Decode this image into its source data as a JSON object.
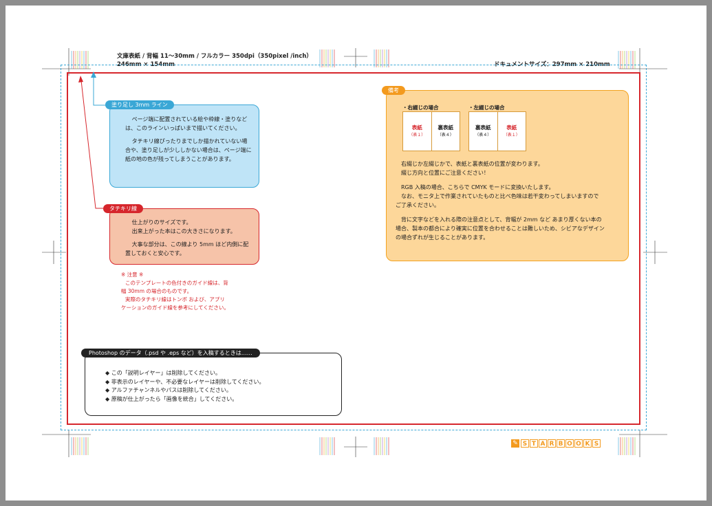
{
  "header": {
    "title_line1": "文庫表紙 / 背幅 11〜30mm / フルカラー 350dpi（350pixel /inch）",
    "title_line2": "246mm × 154mm",
    "doc_size": "ドキュメントサイズ：297mm × 210mm"
  },
  "bleed_box": {
    "tag": "塗り足し 3mm ライン",
    "para1": "ページ端に配置されている絵や枠線・塗りなどは、このラインいっぱいまで描いてください。",
    "para2": "タチキリ線ぴったりまでしか描かれていない場合や、塗り足しが少ししかない場合は、ページ端に紙の地の色が残ってしまうことがあります。"
  },
  "trim_box": {
    "tag": "タチキリ線",
    "line1": "仕上がりのサイズです。",
    "line2": "出来上がった本はこの大きさになります。",
    "para2": "大事な部分は、この線より 5mm ほど内側に配置しておくと安心です。"
  },
  "note": {
    "title": "※ 注意 ※",
    "line1": "このテンプレートの色付きのガイド線は、背",
    "line2": "幅 30mm の場合のものです。",
    "line3": "実際のタチキリ線はトンボ および、アプリ",
    "line4": "ケーションのガイド線を参考にしてください。"
  },
  "remarks": {
    "tag": "備考",
    "right_label": "・右綴じの場合",
    "left_label": "・左綴じの場合",
    "right_cells": [
      {
        "main": "表紙",
        "sub": "（表１）",
        "color": "#d6262c"
      },
      {
        "main": "裏表紙",
        "sub": "（表４）",
        "color": "#222222"
      }
    ],
    "left_cells": [
      {
        "main": "裏表紙",
        "sub": "（表４）",
        "color": "#222222"
      },
      {
        "main": "表紙",
        "sub": "（表１）",
        "color": "#d6262c"
      }
    ],
    "p1a": "右綴じか左綴じかで、表紙と裏表紙の位置が変わります。",
    "p1b": "綴じ方向と位置にご注意ください！",
    "p2a": "RGB 入稿の場合、こちらで CMYK モードに変換いたします。",
    "p2b": "なお、モニタ上で作業されていたものと比べ色味は若干変わってしまいますので",
    "p2c": "ご了承ください。",
    "p3a": "背に文字などを入れる際の注意点として、背幅が 2mm など あまり厚くない本の",
    "p3b": "場合、製本の都合により確実に位置を合わせることは難しいため、シビアなデザイン",
    "p3c": "の場合ずれが生じることがあります。"
  },
  "photoshop": {
    "tag": "Photoshop のデータ（.psd や .eps など）を入稿するときは……",
    "items": [
      "◆ この「説明レイヤー」は削除してください。",
      "◆ 非表示のレイヤーや、不必要なレイヤーは削除してください。",
      "◆ アルファチャンネルやパスは削除してください。",
      "◆ 原稿が仕上がったら「画像を統合」してください。"
    ]
  },
  "logo": {
    "letters": [
      "S",
      "T",
      "A",
      "R",
      "B",
      "O",
      "O",
      "K",
      "S"
    ],
    "color": "#f39a1e"
  },
  "colors": {
    "bleed": "#3aa7d6",
    "trim": "#d6262c",
    "bleed_fill": "#bfe4f7",
    "trim_fill": "#f6c3a9",
    "remarks_fill": "#fdd79a",
    "remarks_border": "#f3a21e"
  }
}
